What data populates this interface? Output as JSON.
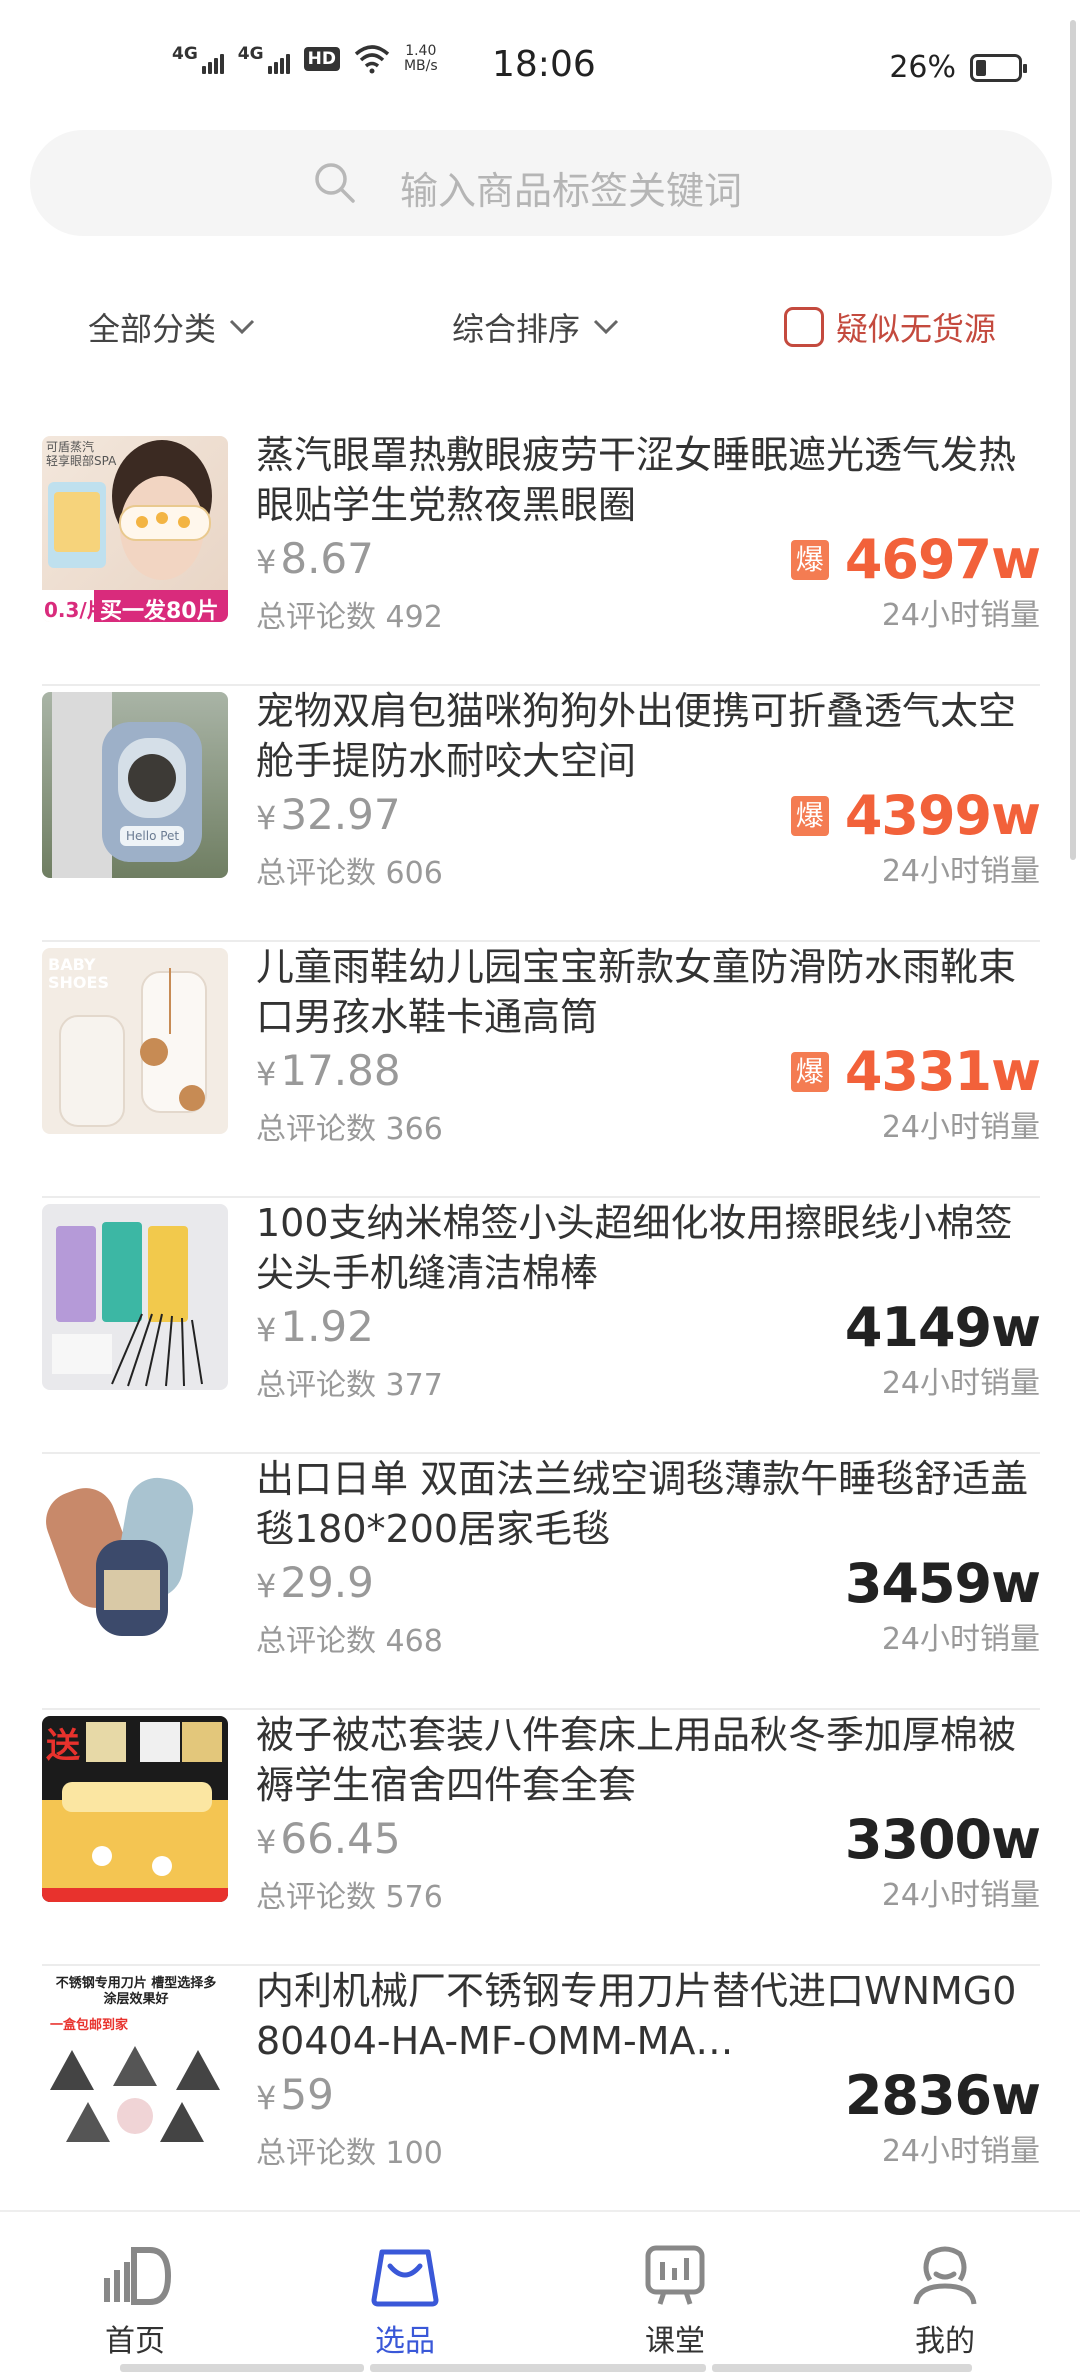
{
  "status_bar": {
    "signal1": "4G",
    "signal2": "4G",
    "hd": "HD",
    "speed_value": "1.40",
    "speed_unit": "MB/s",
    "time": "18:06",
    "battery": "26%"
  },
  "search": {
    "placeholder": "输入商品标签关键词"
  },
  "filters": {
    "category": "全部分类",
    "sort": "综合排序",
    "out_of_stock": "疑似无货源"
  },
  "products": [
    {
      "title": "蒸汽眼罩热敷眼疲劳干涩女睡眠遮光透气发热眼贴学生党熬夜黑眼圈",
      "price_symbol": "¥",
      "price": "8.67",
      "reviews": "总评论数 492",
      "hot": true,
      "hot_label": "爆",
      "sales": "4697w",
      "sales_label": "24小时销量"
    },
    {
      "title": "宠物双肩包猫咪狗狗外出便携可折叠透气太空舱手提防水耐咬大空间",
      "price_symbol": "¥",
      "price": "32.97",
      "reviews": "总评论数 606",
      "hot": true,
      "hot_label": "爆",
      "sales": "4399w",
      "sales_label": "24小时销量"
    },
    {
      "title": "儿童雨鞋幼儿园宝宝新款女童防滑防水雨靴束口男孩水鞋卡通高筒",
      "price_symbol": "¥",
      "price": "17.88",
      "reviews": "总评论数 366",
      "hot": true,
      "hot_label": "爆",
      "sales": "4331w",
      "sales_label": "24小时销量"
    },
    {
      "title": "100支纳米棉签小头超细化妆用擦眼线小棉签尖头手机缝清洁棉棒",
      "price_symbol": "¥",
      "price": "1.92",
      "reviews": "总评论数 377",
      "hot": false,
      "hot_label": "",
      "sales": "4149w",
      "sales_label": "24小时销量"
    },
    {
      "title": "出口日单 双面法兰绒空调毯薄款午睡毯舒适盖毯180*200居家毛毯",
      "price_symbol": "¥",
      "price": "29.9",
      "reviews": "总评论数 468",
      "hot": false,
      "hot_label": "",
      "sales": "3459w",
      "sales_label": "24小时销量"
    },
    {
      "title": "被子被芯套装八件套床上用品秋冬季加厚棉被褥学生宿舍四件套全套",
      "price_symbol": "¥",
      "price": "66.45",
      "reviews": "总评论数 576",
      "hot": false,
      "hot_label": "",
      "sales": "3300w",
      "sales_label": "24小时销量"
    },
    {
      "title": "内利机械厂不锈钢专用刀片替代进口WNMG080404-HA-MF-OMM-MA…",
      "price_symbol": "¥",
      "price": "59",
      "reviews": "总评论数 100",
      "hot": false,
      "hot_label": "",
      "sales": "2836w",
      "sales_label": "24小时销量"
    }
  ],
  "thumbs": {
    "p1_top": "可盾蒸汽\n轻享眼部SPA",
    "p1_price": "0.3/片",
    "p1_promo": "买一发80片",
    "p2_tag": "Hello Pet",
    "p3_text": "BABY\nSHOES",
    "p6_word": "送",
    "p7_text": "不锈钢专用刀片 槽型选择多\n涂层效果好",
    "p7_sub": "一盒包邮到家"
  },
  "nav": [
    {
      "label": "首页",
      "icon": "home-icon",
      "active": false
    },
    {
      "label": "选品",
      "icon": "shopping-bag-icon",
      "active": true
    },
    {
      "label": "课堂",
      "icon": "classroom-icon",
      "active": false
    },
    {
      "label": "我的",
      "icon": "profile-icon",
      "active": false
    }
  ],
  "colors": {
    "accent_blue": "#3a58d8",
    "hot_orange": "#f2613a",
    "checkbox_red": "#c44a3e"
  }
}
